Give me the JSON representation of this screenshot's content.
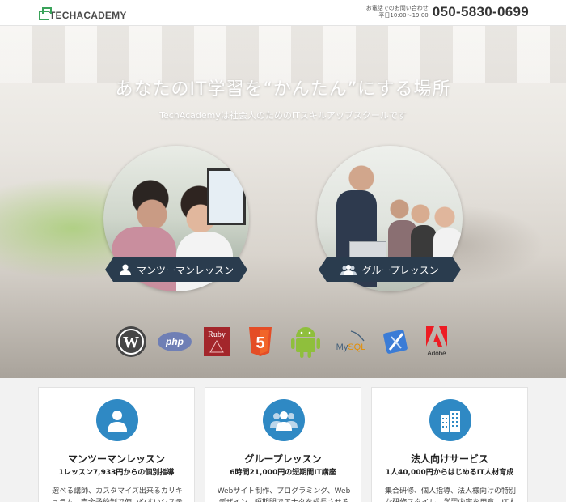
{
  "header": {
    "logo_text": "TECHACADEMY",
    "phone_note_line1": "お電話でのお問い合わせ",
    "phone_note_line2": "平日10:00〜19:00",
    "phone_number": "050-5830-0699"
  },
  "hero": {
    "title": "あなたのIT学習を“かんたん”にする場所",
    "subtitle": "TechAcademyは社会人のためのITスキルアップスクールです",
    "course_buttons": [
      {
        "label": "マンツーマンレッスン",
        "icon": "person-icon"
      },
      {
        "label": "グループレッスン",
        "icon": "group-icon"
      }
    ],
    "tech_logos": [
      {
        "name": "WordPress",
        "icon": "wordpress-icon"
      },
      {
        "name": "php",
        "icon": "php-icon"
      },
      {
        "name": "Ruby",
        "icon": "ruby-icon"
      },
      {
        "name": "5",
        "icon": "html5-icon"
      },
      {
        "name": "Android",
        "icon": "android-icon"
      },
      {
        "name": "MySQL",
        "icon": "mysql-icon"
      },
      {
        "name": "Xcode",
        "icon": "xcode-icon"
      },
      {
        "name": "Adobe",
        "icon": "adobe-icon"
      }
    ]
  },
  "services": [
    {
      "title": "マンツーマンレッスン",
      "subtitle": "1レッスン7,933円からの個別指導",
      "description": "選べる講師、カスタマイズ出来るカリキュラム、完全予約制で使いやすいシステムを実",
      "icon": "person-icon"
    },
    {
      "title": "グループレッスン",
      "subtitle": "6時間21,000円の短期間IT講座",
      "description": "Webサイト制作、プログラミング、Webデザイン、短期間でアナタを成長させる初心者",
      "icon": "group-icon"
    },
    {
      "title": "法人向けサービス",
      "subtitle": "1人40,000円からはじめるIT人材育成",
      "description": "集合研修、個人指導、法人様向けの特別な研修スタイル。学習内容を用意、IT人材は採る",
      "icon": "building-icon"
    }
  ],
  "colors": {
    "ribbon": "#2a3c4e",
    "card_icon": "#2f89c4",
    "logo_green": "#3aa35a"
  }
}
